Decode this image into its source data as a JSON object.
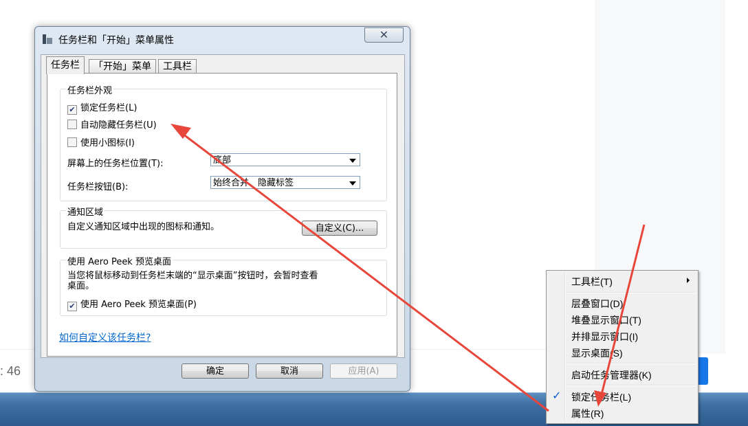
{
  "background": {
    "page_count": ": 46",
    "accent_color": "#1677e6"
  },
  "dialog": {
    "title": "任务栏和「开始」菜单属性",
    "close_label": "✕",
    "tabs": [
      {
        "label": "任务栏",
        "active": true
      },
      {
        "label": "「开始」菜单",
        "active": false
      },
      {
        "label": "工具栏",
        "active": false
      }
    ],
    "appearance": {
      "title": "任务栏外观",
      "lock_label": "锁定任务栏(L)",
      "lock_checked": true,
      "autohide_label": "自动隐藏任务栏(U)",
      "autohide_checked": false,
      "small_icons_label": "使用小图标(I)",
      "small_icons_checked": false,
      "position_label": "屏幕上的任务栏位置(T):",
      "position_value": "底部",
      "buttons_label": "任务栏按钮(B):",
      "buttons_value": "始终合并、隐藏标签"
    },
    "notification": {
      "title": "通知区域",
      "description": "自定义通知区域中出现的图标和通知。",
      "customize_label": "自定义(C)..."
    },
    "aero_peek": {
      "title": "使用 Aero Peek 预览桌面",
      "description_line1": "当您将鼠标移动到任务栏末端的“显示桌面”按钮时，会暂时查看",
      "description_line2": "桌面。",
      "checkbox_label": "使用 Aero Peek 预览桌面(P)",
      "checked": true
    },
    "help_link": "如何自定义该任务栏?",
    "ok_label": "确定",
    "cancel_label": "取消",
    "apply_label": "应用(A)"
  },
  "context_menu": {
    "items": [
      {
        "label": "工具栏(T)",
        "submenu": true
      },
      {
        "label": "层叠窗口(D)"
      },
      {
        "label": "堆叠显示窗口(T)"
      },
      {
        "label": "并排显示窗口(I)"
      },
      {
        "label": "显示桌面(S)"
      },
      {
        "label": "启动任务管理器(K)"
      },
      {
        "label": "锁定任务栏(L)",
        "checked": true
      },
      {
        "label": "属性(R)"
      }
    ],
    "check_mark": "✓"
  },
  "annotation_color": "#e8463a"
}
